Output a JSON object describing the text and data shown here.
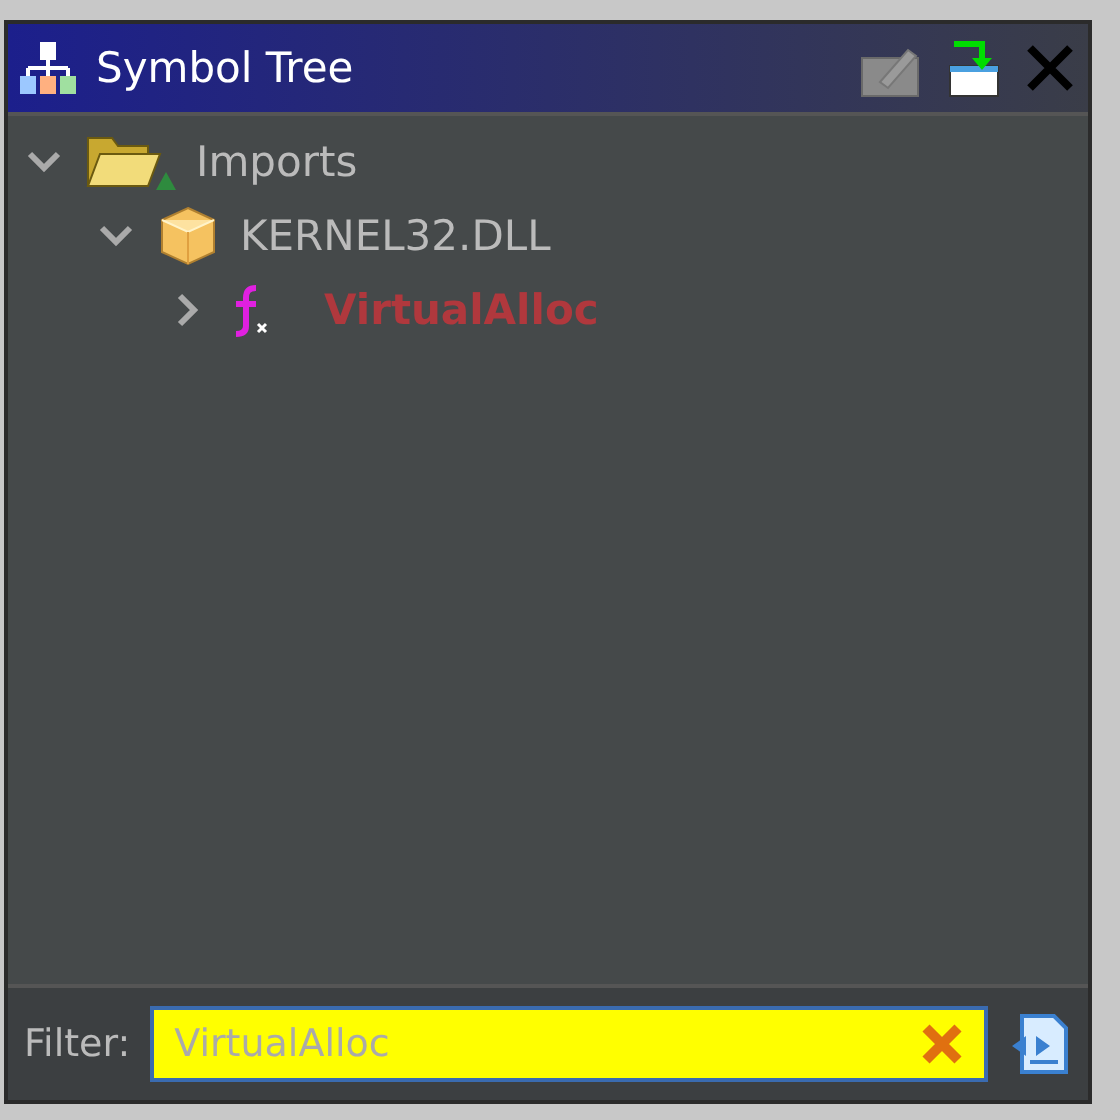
{
  "window": {
    "title": "Symbol Tree"
  },
  "tree": [
    {
      "label": "Imports",
      "kind": "folder",
      "expanded": true,
      "highlighted": false,
      "children": [
        {
          "label": "KERNEL32.DLL",
          "kind": "library",
          "expanded": true,
          "highlighted": false,
          "children": [
            {
              "label": "VirtualAlloc",
              "kind": "function",
              "expanded": false,
              "highlighted": true
            }
          ]
        }
      ]
    }
  ],
  "filter": {
    "label": "Filter:",
    "value": "VirtualAlloc"
  }
}
